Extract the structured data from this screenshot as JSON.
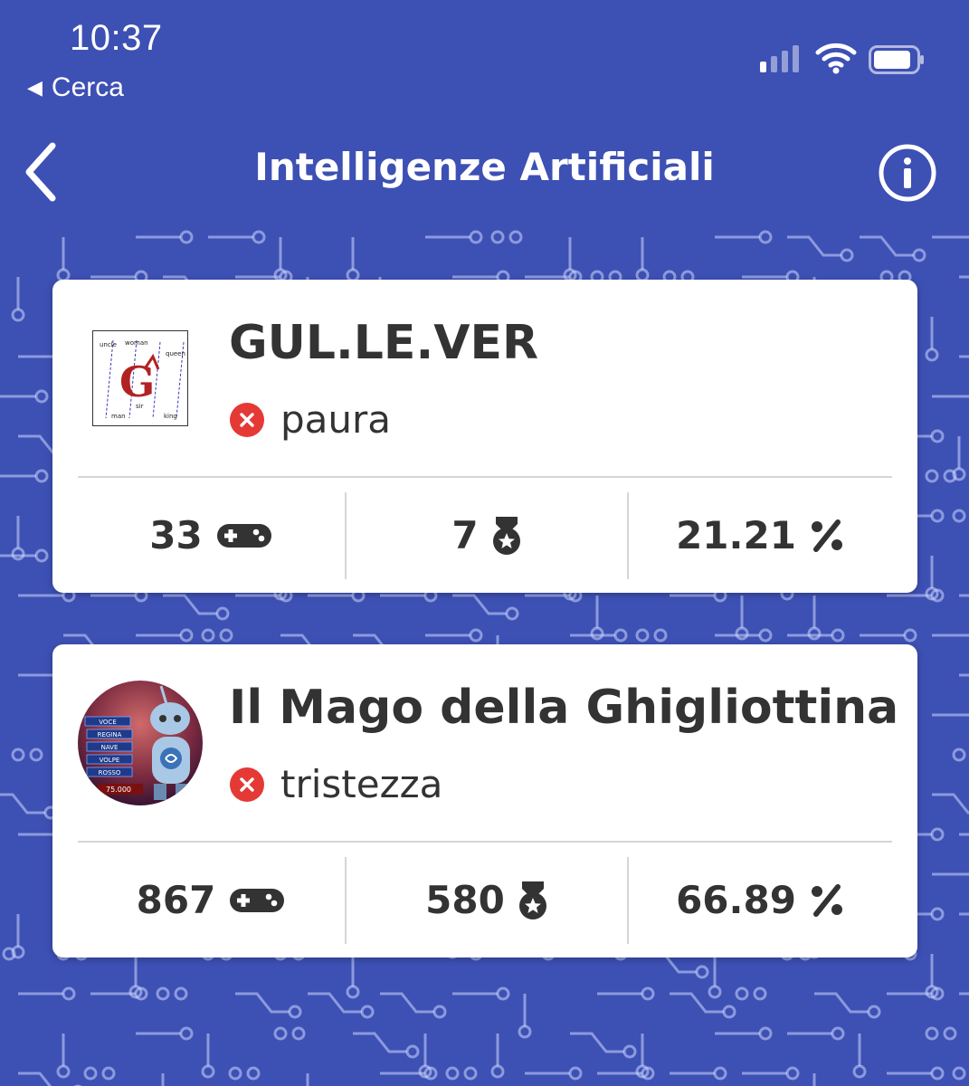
{
  "status_bar": {
    "time": "10:37",
    "back_app": "Cerca"
  },
  "nav": {
    "title": "Intelligenze Artificiali"
  },
  "colors": {
    "background": "#3d50b4",
    "card": "#ffffff",
    "error": "#e53935",
    "text": "#333333"
  },
  "bots": [
    {
      "name": "GUL.LE.VER",
      "status_icon": "x-circle-icon",
      "status": "paura",
      "logo_words": [
        "uncle",
        "woman",
        "queen",
        "man",
        "sir",
        "king"
      ],
      "games": "33",
      "wins": "7",
      "percent": "21.21"
    },
    {
      "name": "Il Mago della Ghigliottina",
      "status_icon": "x-circle-icon",
      "status": "tristezza",
      "avatar_words": [
        "VOCE",
        "REGINA",
        "NAVE",
        "VOLPE",
        "ROSSO",
        "75.000"
      ],
      "games": "867",
      "wins": "580",
      "percent": "66.89"
    }
  ]
}
